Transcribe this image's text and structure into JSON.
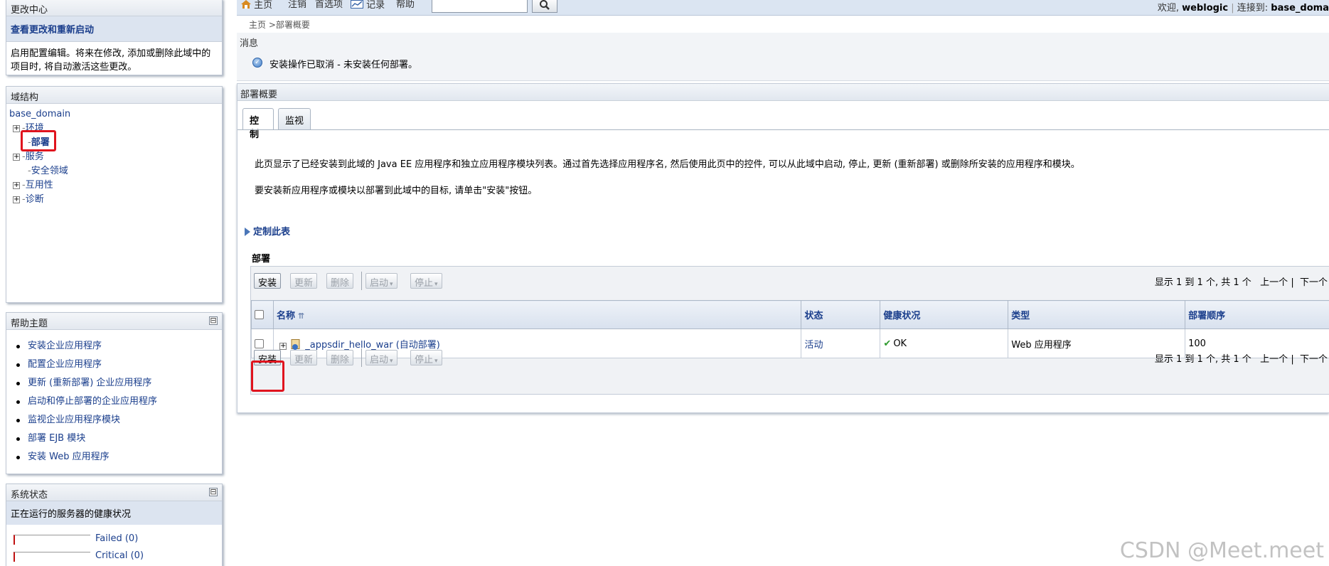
{
  "change_center": {
    "title": "更改中心",
    "view_changes_link": "查看更改和重新启动",
    "description": "启用配置编辑。将来在修改, 添加或删除此域中的项目时, 将自动激活这些更改。"
  },
  "domain_structure": {
    "title": "域结构",
    "root": "base_domain",
    "items": [
      {
        "label": "环境",
        "expandable": true
      },
      {
        "label": "部署",
        "expandable": false,
        "selected": true
      },
      {
        "label": "服务",
        "expandable": true
      },
      {
        "label": "安全领域",
        "expandable": false
      },
      {
        "label": "互用性",
        "expandable": true
      },
      {
        "label": "诊断",
        "expandable": true
      }
    ]
  },
  "help_topics": {
    "title": "帮助主题",
    "collapse_glyph": "⊟",
    "items": [
      "安装企业应用程序",
      "配置企业应用程序",
      "更新 (重新部署) 企业应用程序",
      "启动和停止部署的企业应用程序",
      "监视企业应用程序模块",
      "部署 EJB 模块",
      "安装 Web 应用程序"
    ]
  },
  "system_status": {
    "title": "系统状态",
    "caption": "正在运行的服务器的健康状况",
    "rows": [
      {
        "label": "Failed (0)",
        "fraction": 0
      },
      {
        "label": "Critical (0)",
        "fraction": 0
      }
    ]
  },
  "topbar": {
    "home": "主页",
    "logout": "注销",
    "preferences": "首选项",
    "record": "记录",
    "help": "帮助",
    "search_placeholder": "",
    "welcome_prefix": "欢迎, ",
    "user": "weblogic",
    "connected_prefix": "连接到: ",
    "domain": "base_doma"
  },
  "breadcrumb": "主页 >部署概要",
  "messages": {
    "title": "消息",
    "text": "安装操作已取消 - 未安装任何部署。"
  },
  "overview": {
    "title": "部署概要",
    "tabs": [
      "控制",
      "监视"
    ],
    "description1": "此页显示了已经安装到此域的 Java EE 应用程序和独立应用程序模块列表。通过首先选择应用程序名, 然后使用此页中的控件, 可以从此域中启动, 停止, 更新 (重新部署) 或删除所安装的应用程序和模块。",
    "description2": "要安装新应用程序或模块以部署到此域中的目标, 请单击\"安装\"按钮。",
    "customize_link": "定制此表",
    "section_title": "部署"
  },
  "toolbar": {
    "install": "安装",
    "update": "更新",
    "delete": "删除",
    "start": "启动",
    "stop": "停止",
    "pager_text": "显示 1 到 1 个, 共 1 个",
    "prev": "上一个",
    "separator": "|",
    "next": "下一个"
  },
  "table": {
    "columns": [
      "名称",
      "状态",
      "健康状况",
      "类型",
      "部署顺序"
    ],
    "rows": [
      {
        "name": "_appsdir_hello_war (自动部署)",
        "state": "活动",
        "health": "OK",
        "type": "Web 应用程序",
        "order": "100"
      }
    ]
  },
  "watermark": "CSDN @Meet.meet",
  "colors": {
    "link": "#1a3e8c",
    "highlight_red": "#e0141e",
    "ok_green": "#2f9a2f"
  }
}
